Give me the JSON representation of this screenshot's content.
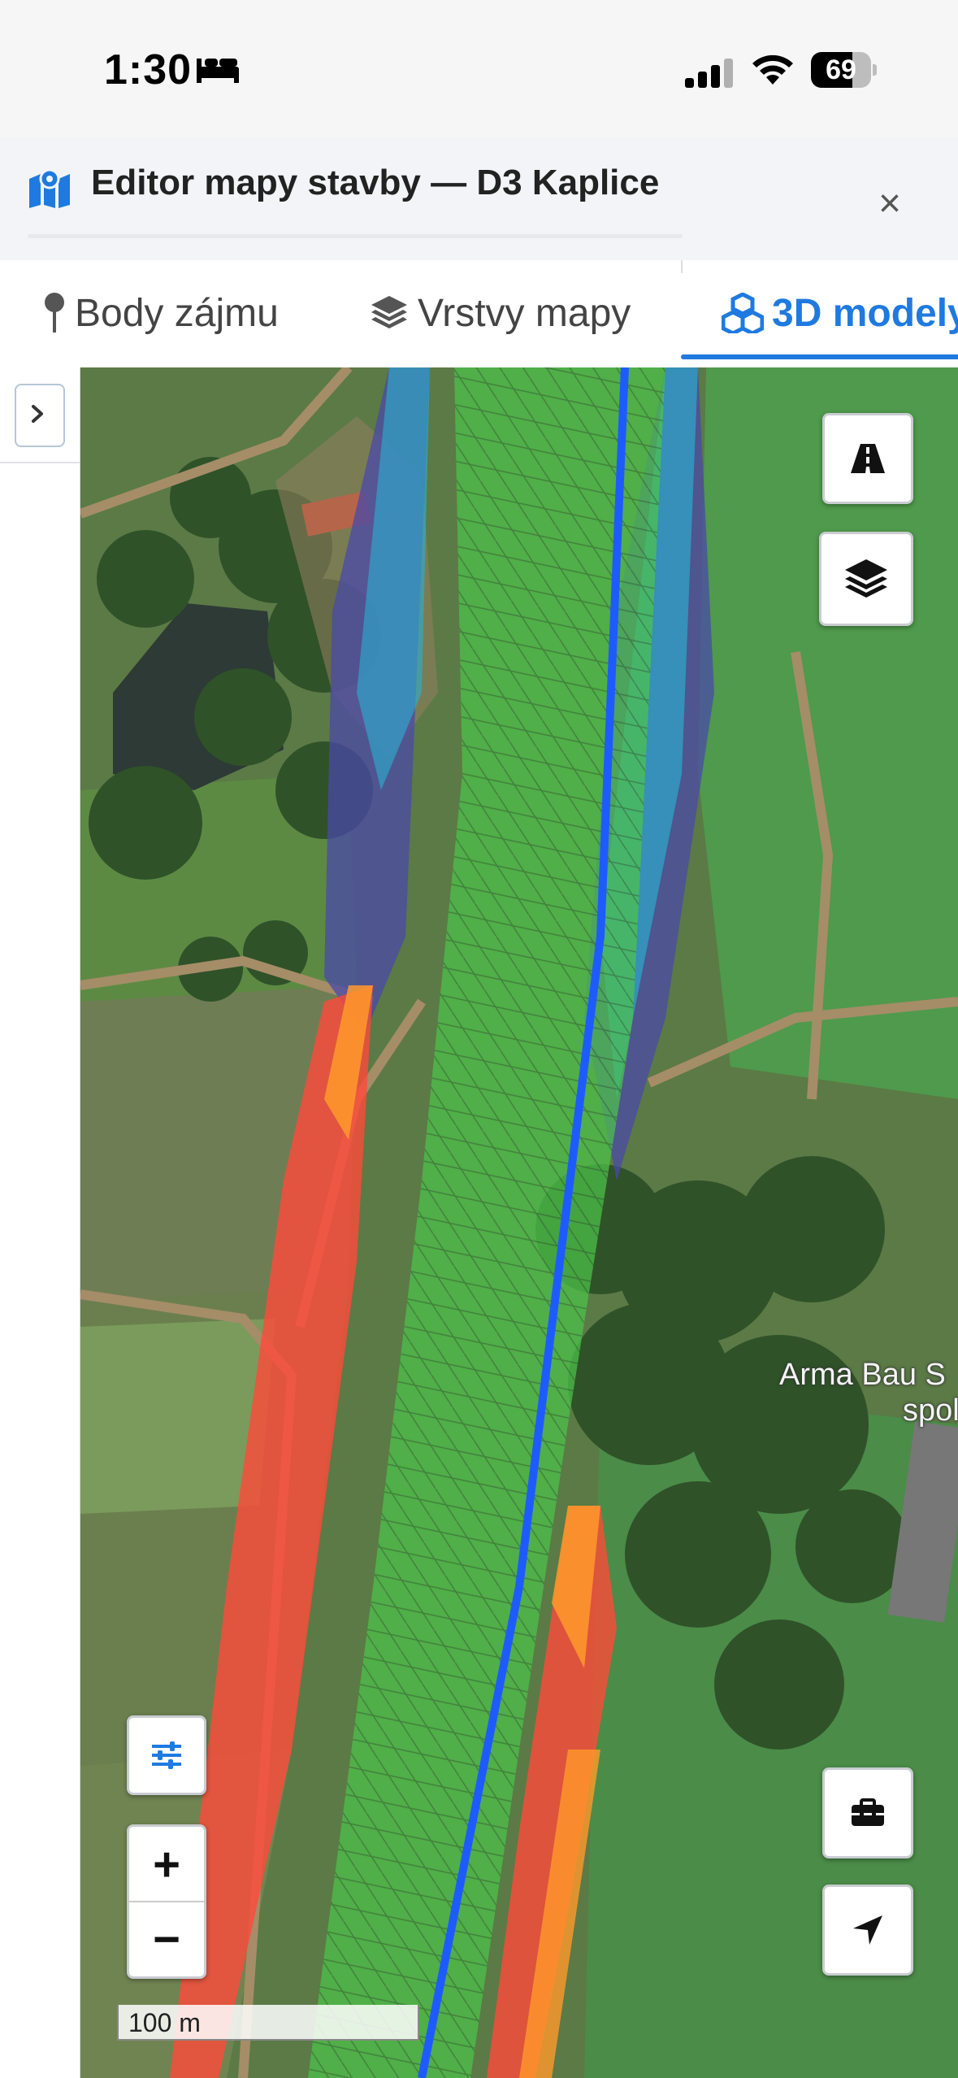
{
  "status_bar": {
    "time": "1:30",
    "battery": "69",
    "battery_level": 0.69
  },
  "header": {
    "title": "Editor mapy stavby — D3 Kaplice",
    "close_label": "×"
  },
  "tabs": [
    {
      "label": "Body zájmu",
      "icon": "map-pin-icon",
      "active": false
    },
    {
      "label": "Vrstvy mapy",
      "icon": "layers-icon",
      "active": false
    },
    {
      "label": "3D modely",
      "icon": "cubes-icon",
      "active": true
    }
  ],
  "map": {
    "place_label_1": "Arma Bau S",
    "place_label_2": "spol",
    "scale_label": "100 m",
    "zoom_in": "+",
    "zoom_out": "−"
  },
  "colors": {
    "accent": "#1f7ae0",
    "road_line": "#1e5bff",
    "model_green": "#4cc34a",
    "model_red": "#ff4a3a",
    "model_orange": "#ff9a2a",
    "model_cyan": "#2ab0d0",
    "model_indigo": "#4a4aa8"
  }
}
